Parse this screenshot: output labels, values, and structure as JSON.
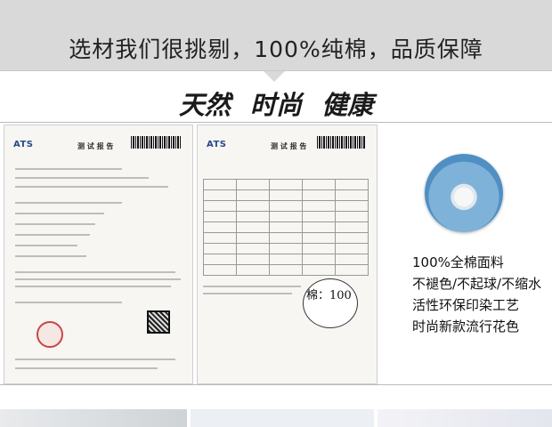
{
  "banner": {
    "title": "选材我们很挑剔，100%纯棉，品质保障"
  },
  "subtitle": "天然  时尚  健康",
  "reports": [
    {
      "logo": "ATS",
      "title": "测 试 报 告"
    },
    {
      "logo": "ATS",
      "title": "测 试 报 告"
    }
  ],
  "cotton_badge": "棉：100",
  "features": [
    "100%全棉面料",
    "不褪色/不起球/不缩水",
    "活性环保印染工艺",
    "时尚新款流行花色"
  ]
}
